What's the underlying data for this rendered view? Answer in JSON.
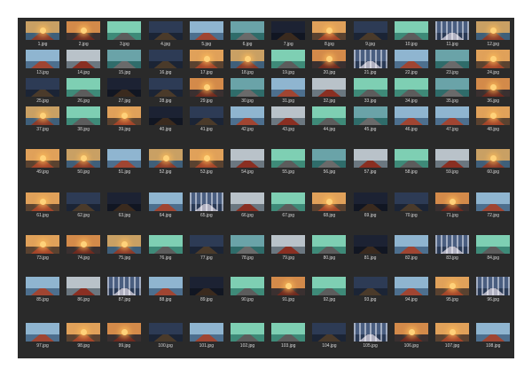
{
  "files": [
    "1.jpg",
    "2.jpg",
    "3.jpg",
    "4.jpg",
    "5.jpg",
    "6.jpg",
    "7.jpg",
    "8.jpg",
    "9.jpg",
    "10.jpg",
    "11.jpg",
    "12.jpg",
    "13.jpg",
    "14.jpg",
    "15.jpg",
    "16.jpg",
    "17.jpg",
    "18.jpg",
    "19.jpg",
    "20.jpg",
    "21.jpg",
    "22.jpg",
    "23.jpg",
    "24.jpg",
    "25.jpg",
    "26.jpg",
    "27.jpg",
    "28.jpg",
    "29.jpg",
    "30.jpg",
    "31.jpg",
    "32.jpg",
    "33.jpg",
    "34.jpg",
    "35.jpg",
    "36.jpg",
    "37.jpg",
    "38.jpg",
    "39.jpg",
    "40.jpg",
    "41.jpg",
    "42.jpg",
    "43.jpg",
    "44.jpg",
    "45.jpg",
    "46.jpg",
    "47.jpg",
    "48.jpg",
    "49.jpg",
    "50.jpg",
    "51.jpg",
    "52.jpg",
    "53.jpg",
    "54.jpg",
    "55.jpg",
    "56.jpg",
    "57.jpg",
    "58.jpg",
    "59.jpg",
    "60.jpg",
    "61.jpg",
    "62.jpg",
    "63.jpg",
    "64.jpg",
    "65.jpg",
    "66.jpg",
    "67.jpg",
    "68.jpg",
    "69.jpg",
    "70.jpg",
    "71.jpg",
    "72.jpg",
    "73.jpg",
    "74.jpg",
    "75.jpg",
    "76.jpg",
    "77.jpg",
    "78.jpg",
    "79.jpg",
    "80.jpg",
    "81.jpg",
    "82.jpg",
    "83.jpg",
    "84.jpg",
    "85.jpg",
    "86.jpg",
    "87.jpg",
    "88.jpg",
    "89.jpg",
    "90.jpg",
    "91.jpg",
    "92.jpg",
    "93.jpg",
    "94.jpg",
    "95.jpg",
    "96.jpg",
    "97.jpg",
    "98.jpg",
    "99.jpg",
    "100.jpg",
    "101.jpg",
    "102.jpg",
    "103.jpg",
    "104.jpg",
    "105.jpg",
    "106.jpg",
    "107.jpg",
    "108.jpg"
  ],
  "colors": {
    "background": "#2a2a2a",
    "label_text": "#d8d8d8"
  },
  "thumbnail_styles": [
    {
      "sky": "#c9a064",
      "sea": "#3f5f7a",
      "deck": "#8a3a2a",
      "sun": true
    },
    {
      "sky": "#6aa3a8",
      "sea": "#2f6c6a",
      "deck": "#6a6a6a",
      "sun": false
    },
    {
      "sky": "#2d3b55",
      "sea": "#1b2435",
      "deck": "#4a3a2a",
      "sun": false
    },
    {
      "sky": "#d38a4a",
      "sea": "#3a3030",
      "deck": "#6e2a20",
      "sun": true
    },
    {
      "sky": "#8fb5d0",
      "sea": "#4d6f8e",
      "deck": "#a04532",
      "sun": false
    },
    {
      "sky": "#7ecfb3",
      "sea": "#3e8a78",
      "deck": "#5c5c5c",
      "sun": false
    },
    {
      "sky": "#1c2233",
      "sea": "#111622",
      "deck": "#3a2a1e",
      "sun": false
    },
    {
      "sky": "#b9c2c9",
      "sea": "#6b7780",
      "deck": "#8a2f22",
      "sun": false
    },
    {
      "sky": "#e0a15a",
      "sea": "#5a4230",
      "deck": "#a4452a",
      "sun": true
    },
    {
      "sky": "#4a5e80",
      "sea": "#2a3a55",
      "deck": "#b0b0c0",
      "sun": false,
      "cranes": true
    }
  ],
  "thumbnail_pattern": [
    0,
    3,
    5,
    2,
    4,
    1,
    6,
    8,
    2,
    5,
    9,
    0,
    4,
    7,
    1,
    2,
    8,
    0,
    5,
    3,
    9,
    4,
    1,
    8,
    2,
    5,
    6,
    2,
    3,
    1,
    4,
    7,
    5,
    5,
    1,
    3,
    0,
    5,
    8,
    6,
    2,
    4,
    7,
    5,
    1,
    4,
    4,
    8,
    8,
    0,
    4,
    0,
    8,
    7,
    5,
    1,
    7,
    5,
    7,
    0,
    8,
    2,
    6,
    4,
    9,
    7,
    5,
    8,
    6,
    2,
    3,
    4,
    8,
    3,
    0,
    5,
    2,
    1,
    7,
    5,
    6,
    4,
    9,
    5,
    4,
    7,
    9,
    4,
    6,
    5,
    3,
    5,
    2,
    4,
    8,
    9,
    4,
    8,
    3,
    2,
    4,
    5,
    5,
    2,
    9,
    3,
    8,
    4
  ]
}
